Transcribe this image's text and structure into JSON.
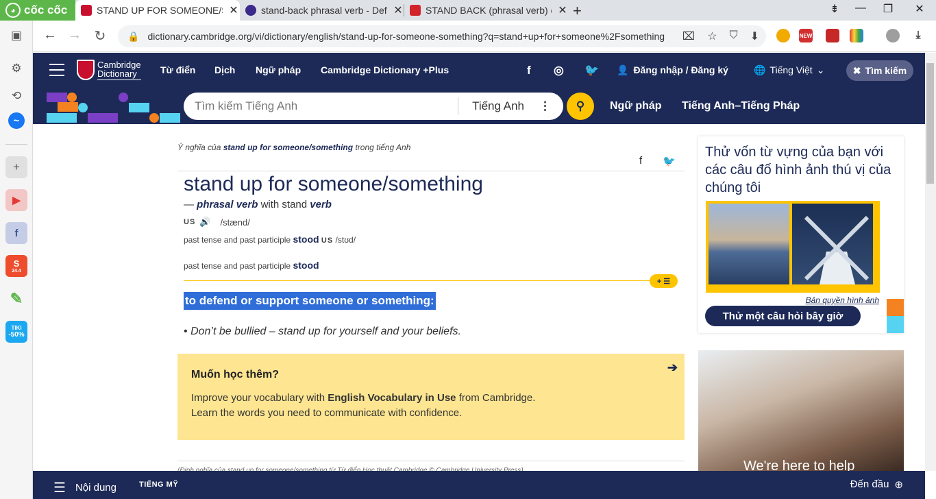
{
  "browser": {
    "brand": "cốc cốc",
    "tabs": [
      {
        "title": "STAND UP FOR SOMEONE/SOMETHING",
        "active": true
      },
      {
        "title": "stand-back phrasal verb - Definition",
        "active": false
      },
      {
        "title": "STAND BACK (phrasal verb) definition",
        "active": false
      }
    ],
    "new_tab": "+",
    "url": "dictionary.cambridge.org/vi/dictionary/english/stand-up-for-someone-something?q=stand+up+for+someone%2Fsomething",
    "ext_new_badge": "NEW"
  },
  "sidebar": {
    "shopee_badge": "24.4",
    "tiki_label": "TIKI",
    "tiki_discount": "-50%"
  },
  "site_header": {
    "logo_line1": "Cambridge",
    "logo_line2": "Dictionary",
    "nav": [
      "Từ điển",
      "Dịch",
      "Ngữ pháp",
      "Cambridge Dictionary +Plus"
    ],
    "login": "Đăng nhập / Đăng ký",
    "language": "Tiếng Việt",
    "search_toggle": "Tìm kiếm"
  },
  "search": {
    "placeholder": "Tìm kiếm Tiếng Anh",
    "dictionary": "Tiếng Anh",
    "links": [
      "Ngữ pháp",
      "Tiếng Anh–Tiếng Pháp"
    ]
  },
  "entry": {
    "crumb_prefix": "Ý nghĩa của",
    "crumb_term": "stand up for someone/something",
    "crumb_suffix": "trong tiếng Anh",
    "headword": "stand up for someone/something",
    "pos_dash": "—",
    "pos": "phrasal verb",
    "pos_with": "with stand",
    "pos_verb": "verb",
    "region": "US",
    "ipa": "/stænd/",
    "past1_label": "past tense and past participle",
    "past1_word": "stood",
    "past1_region": "US",
    "past1_ipa": "/stʊd/",
    "past2_label": "past tense and past participle",
    "past2_word": "stood",
    "definition": "to defend or support someone or something:",
    "example": "Don’t be bullied – stand up for yourself and your beliefs.",
    "list_button": "+ ☰"
  },
  "learn_more": {
    "heading": "Muốn học thêm?",
    "line1_pre": "Improve your vocabulary with ",
    "line1_bold": "English Vocabulary in Use",
    "line1_post": " from Cambridge.",
    "line2": "Learn the words you need to communicate with confidence."
  },
  "citation": "(Định nghĩa của stand up for someone/something từ Từ điển Học thuật Cambridge © Cambridge University Press)",
  "quiz": {
    "title": "Thử vốn từ vựng của bạn với các câu đố hình ảnh thú vị của chúng tôi",
    "copyright": "Bản quyền hình ảnh",
    "button": "Thử một câu hỏi bây giờ"
  },
  "ad": {
    "caption": "We're here to help"
  },
  "bottom_bar": {
    "menu": "Nội dung",
    "region": "TIẾNG MỸ",
    "to_top": "Đến đầu"
  },
  "colors": {
    "brand_navy": "#1d2a57",
    "accent_yellow": "#fec400",
    "highlight_blue": "#2f6ed8",
    "learn_box": "#fde591"
  }
}
